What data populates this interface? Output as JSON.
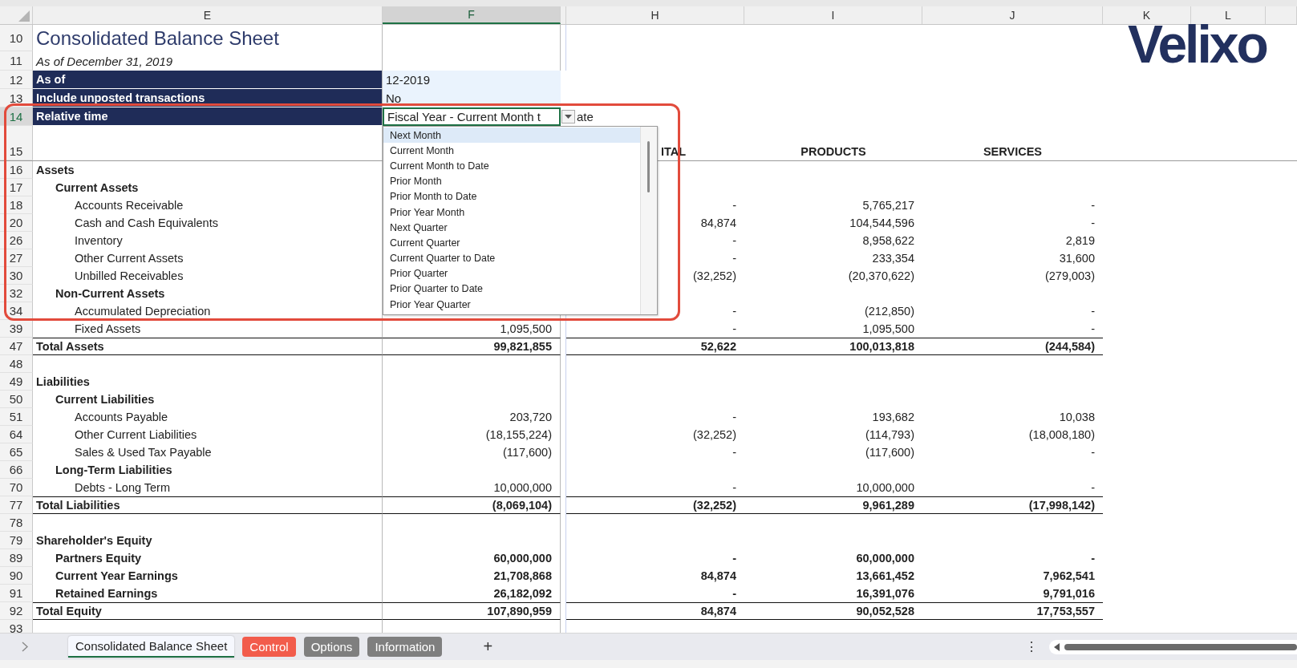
{
  "columns": [
    {
      "label": "E",
      "selected": false
    },
    {
      "label": "F",
      "selected": true
    },
    {
      "label": "H",
      "selected": false
    },
    {
      "label": "I",
      "selected": false
    },
    {
      "label": "J",
      "selected": false
    },
    {
      "label": "K",
      "selected": false
    },
    {
      "label": "L",
      "selected": false
    }
  ],
  "title": {
    "row": "10",
    "text": "Consolidated Balance Sheet"
  },
  "subtitle": {
    "row": "11",
    "text": "As of December 31, 2019"
  },
  "parameters": [
    {
      "row": "12",
      "label": "As of",
      "value": "12-2019",
      "selected": false
    },
    {
      "row": "13",
      "label": "Include unposted transactions",
      "value": "No",
      "selected": false
    },
    {
      "row": "14",
      "label": "Relative time",
      "value": "Fiscal Year - Current Month t",
      "value_overflow": "ate",
      "selected": true
    }
  ],
  "column_headings": {
    "row": "15",
    "h": "ITAL",
    "i": "PRODUCTS",
    "j": "SERVICES"
  },
  "rows": [
    {
      "kind": "header",
      "row": "16",
      "label": "Assets",
      "children": [
        {
          "kind": "header",
          "row": "17",
          "label": "Current Assets",
          "children": [
            {
              "kind": "line",
              "row": "18",
              "label": "Accounts Receivable",
              "h": "-",
              "i": "5,765,217",
              "j": "-"
            },
            {
              "kind": "line",
              "row": "20",
              "label": "Cash and Cash Equivalents",
              "h": "84,874",
              "i": "104,544,596",
              "j": "-"
            },
            {
              "kind": "line",
              "row": "26",
              "label": "Inventory",
              "h": "-",
              "i": "8,958,622",
              "j": "2,819"
            },
            {
              "kind": "line",
              "row": "27",
              "label": "Other Current Assets",
              "h": "-",
              "i": "233,354",
              "j": "31,600"
            },
            {
              "kind": "line",
              "row": "30",
              "label": "Unbilled Receivables",
              "h": "(32,252)",
              "i": "(20,370,622)",
              "j": "(279,003)"
            }
          ]
        },
        {
          "kind": "header",
          "row": "32",
          "label": "Non-Current Assets",
          "children": [
            {
              "kind": "line",
              "row": "34",
              "label": "Accumulated Depreciation",
              "h": "-",
              "i": "(212,850)",
              "j": "-"
            },
            {
              "kind": "line",
              "row": "39",
              "label": "Fixed Assets",
              "f": "1,095,500",
              "h": "-",
              "i": "1,095,500",
              "j": "-"
            }
          ]
        }
      ]
    },
    {
      "kind": "total",
      "row": "47",
      "label": "Total Assets",
      "f": "99,821,855",
      "h": "52,622",
      "i": "100,013,818",
      "j": "(244,584)"
    },
    {
      "kind": "blank",
      "row": "48"
    },
    {
      "kind": "header",
      "row": "49",
      "label": "Liabilities",
      "children": [
        {
          "kind": "header",
          "row": "50",
          "label": "Current Liabilities",
          "children": [
            {
              "kind": "line",
              "row": "51",
              "label": "Accounts Payable",
              "f": "203,720",
              "h": "-",
              "i": "193,682",
              "j": "10,038"
            },
            {
              "kind": "line",
              "row": "64",
              "label": "Other Current Liabilities",
              "f": "(18,155,224)",
              "h": "(32,252)",
              "i": "(114,793)",
              "j": "(18,008,180)"
            },
            {
              "kind": "line",
              "row": "65",
              "label": "Sales & Used Tax Payable",
              "f": "(117,600)",
              "h": "-",
              "i": "(117,600)",
              "j": "-"
            }
          ]
        },
        {
          "kind": "header",
          "row": "66",
          "label": "Long-Term Liabilities",
          "children": [
            {
              "kind": "line",
              "row": "70",
              "label": "Debts - Long Term",
              "f": "10,000,000",
              "h": "-",
              "i": "10,000,000",
              "j": "-"
            }
          ]
        }
      ]
    },
    {
      "kind": "total",
      "row": "77",
      "label": "Total Liabilities",
      "f": "(8,069,104)",
      "h": "(32,252)",
      "i": "9,961,289",
      "j": "(17,998,142)"
    },
    {
      "kind": "blank",
      "row": "78"
    },
    {
      "kind": "header",
      "row": "79",
      "label": "Shareholder's Equity",
      "children": [
        {
          "kind": "bold_line",
          "row": "89",
          "label": "Partners Equity",
          "f": "60,000,000",
          "h": "-",
          "i": "60,000,000",
          "j": "-"
        },
        {
          "kind": "bold_line",
          "row": "90",
          "label": "Current Year Earnings",
          "f": "21,708,868",
          "h": "84,874",
          "i": "13,661,452",
          "j": "7,962,541"
        },
        {
          "kind": "bold_line",
          "row": "91",
          "label": "Retained Earnings",
          "f": "26,182,092",
          "h": "-",
          "i": "16,391,076",
          "j": "9,791,016"
        }
      ]
    },
    {
      "kind": "total",
      "row": "92",
      "label": "Total Equity",
      "f": "107,890,959",
      "h": "84,874",
      "i": "90,052,528",
      "j": "17,753,557"
    },
    {
      "kind": "blank",
      "row": "93"
    }
  ],
  "dropdown": {
    "items": [
      {
        "label": "Next Month",
        "selected": true
      },
      {
        "label": "Current Month",
        "selected": false
      },
      {
        "label": "Current Month to Date",
        "selected": false
      },
      {
        "label": "Prior Month",
        "selected": false
      },
      {
        "label": "Prior Month to Date",
        "selected": false
      },
      {
        "label": "Prior Year Month",
        "selected": false
      },
      {
        "label": "Next Quarter",
        "selected": false
      },
      {
        "label": "Current Quarter",
        "selected": false
      },
      {
        "label": "Current Quarter to Date",
        "selected": false
      },
      {
        "label": "Prior Quarter",
        "selected": false
      },
      {
        "label": "Prior Quarter to Date",
        "selected": false
      },
      {
        "label": "Prior Year Quarter",
        "selected": false
      }
    ]
  },
  "logo": "Velixo",
  "tabs": [
    {
      "label": "Consolidated Balance Sheet",
      "selected": true
    },
    {
      "label": "Control",
      "selected": false,
      "color": "#f25c4c"
    },
    {
      "label": "Options",
      "selected": false,
      "color": "#7f7f7f"
    },
    {
      "label": "Information",
      "selected": false,
      "color": "#7f7f7f"
    }
  ],
  "add_sheet": "+",
  "more": "⋮"
}
